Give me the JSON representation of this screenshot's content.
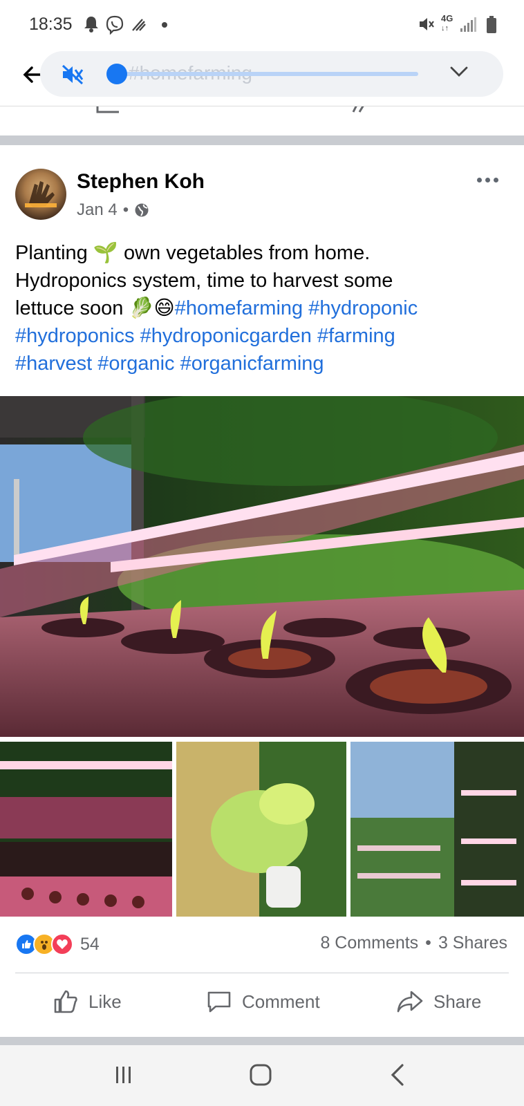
{
  "status_bar": {
    "time": "18:35",
    "icons_left": [
      "bell-icon",
      "viber-icon",
      "signal-wave-icon",
      "dot-icon"
    ],
    "icons_right": [
      "mute-icon",
      "4g-icon",
      "signal-bars-icon",
      "battery-icon"
    ],
    "network_label": "4G"
  },
  "top_bar": {
    "search_query": "#homefarming",
    "media_progress": 0.02
  },
  "post": {
    "author": "Stephen Koh",
    "date": "Jan 4",
    "separator": "•",
    "text_lines": [
      {
        "parts": [
          {
            "t": "Planting 🌱 own vegetables from home.",
            "tag": false
          }
        ]
      },
      {
        "parts": [
          {
            "t": "Hydroponics system, time to harvest some",
            "tag": false
          }
        ]
      },
      {
        "parts": [
          {
            "t": "lettuce soon 🥬😄",
            "tag": false
          },
          {
            "t": "#homefarming",
            "tag": true
          },
          {
            "t": " ",
            "tag": false
          },
          {
            "t": "#hydroponic",
            "tag": true
          }
        ]
      },
      {
        "parts": [
          {
            "t": "#hydroponics",
            "tag": true
          },
          {
            "t": " ",
            "tag": false
          },
          {
            "t": "#hydroponicgarden",
            "tag": true
          },
          {
            "t": " ",
            "tag": false
          },
          {
            "t": "#farming",
            "tag": true
          }
        ]
      },
      {
        "parts": [
          {
            "t": "#harvest",
            "tag": true
          },
          {
            "t": " ",
            "tag": false
          },
          {
            "t": "#organic",
            "tag": true
          },
          {
            "t": " ",
            "tag": false
          },
          {
            "t": "#organicfarming",
            "tag": true
          }
        ]
      }
    ],
    "reaction_count": "54",
    "comments": "8 Comments",
    "shares": "3 Shares",
    "stats_sep": "•"
  },
  "actions": {
    "like": "Like",
    "comment": "Comment",
    "share": "Share"
  },
  "colors": {
    "accent": "#1877f2",
    "hashtag": "#216fdb",
    "secondary_text": "#65676b",
    "divider": "#c9ccd1"
  }
}
